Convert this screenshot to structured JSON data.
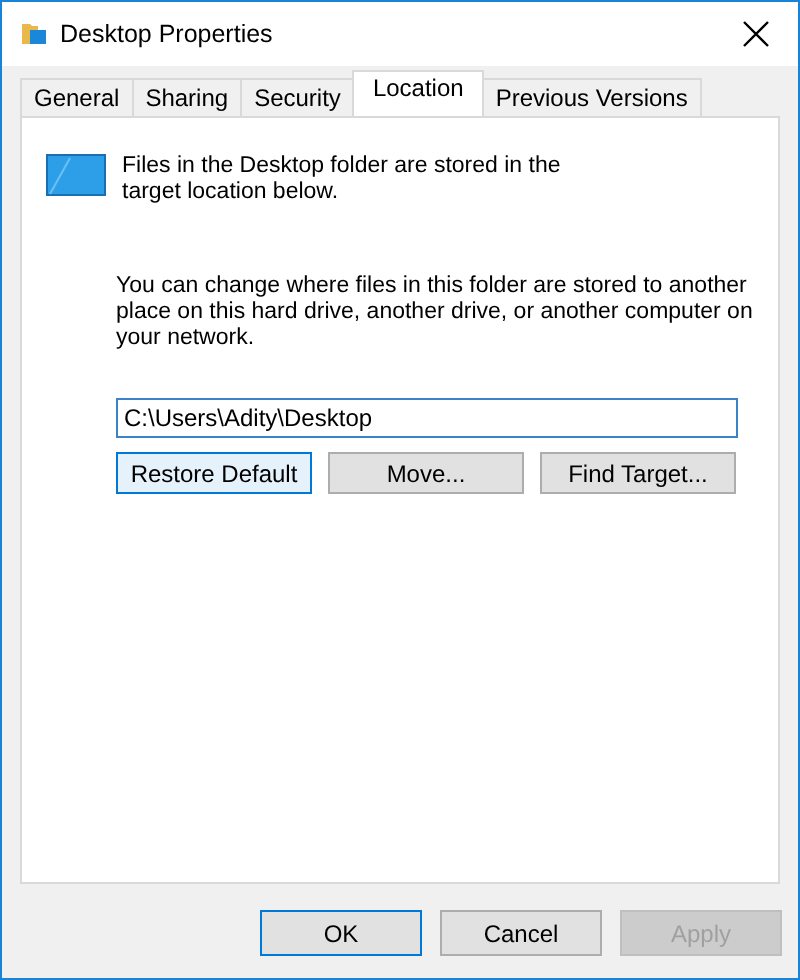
{
  "window": {
    "title": "Desktop Properties"
  },
  "tabs": [
    {
      "label": "General",
      "selected": false
    },
    {
      "label": "Sharing",
      "selected": false
    },
    {
      "label": "Security",
      "selected": false
    },
    {
      "label": "Location",
      "selected": true
    },
    {
      "label": "Previous Versions",
      "selected": false
    }
  ],
  "info": "Files in the Desktop folder are stored in the target location below.",
  "description": "You can change where files in this folder are stored to another place on this hard drive, another drive, or another computer on your network.",
  "path_field": {
    "value": "C:\\Users\\Adity\\Desktop"
  },
  "location_buttons": [
    {
      "label": "Restore Default",
      "focused": true
    },
    {
      "label": "Move...",
      "focused": false
    },
    {
      "label": "Find Target...",
      "focused": false
    }
  ],
  "dialog_buttons": [
    {
      "label": "OK",
      "default": true,
      "disabled": false
    },
    {
      "label": "Cancel",
      "default": false,
      "disabled": false
    },
    {
      "label": "Apply",
      "default": false,
      "disabled": true
    }
  ]
}
